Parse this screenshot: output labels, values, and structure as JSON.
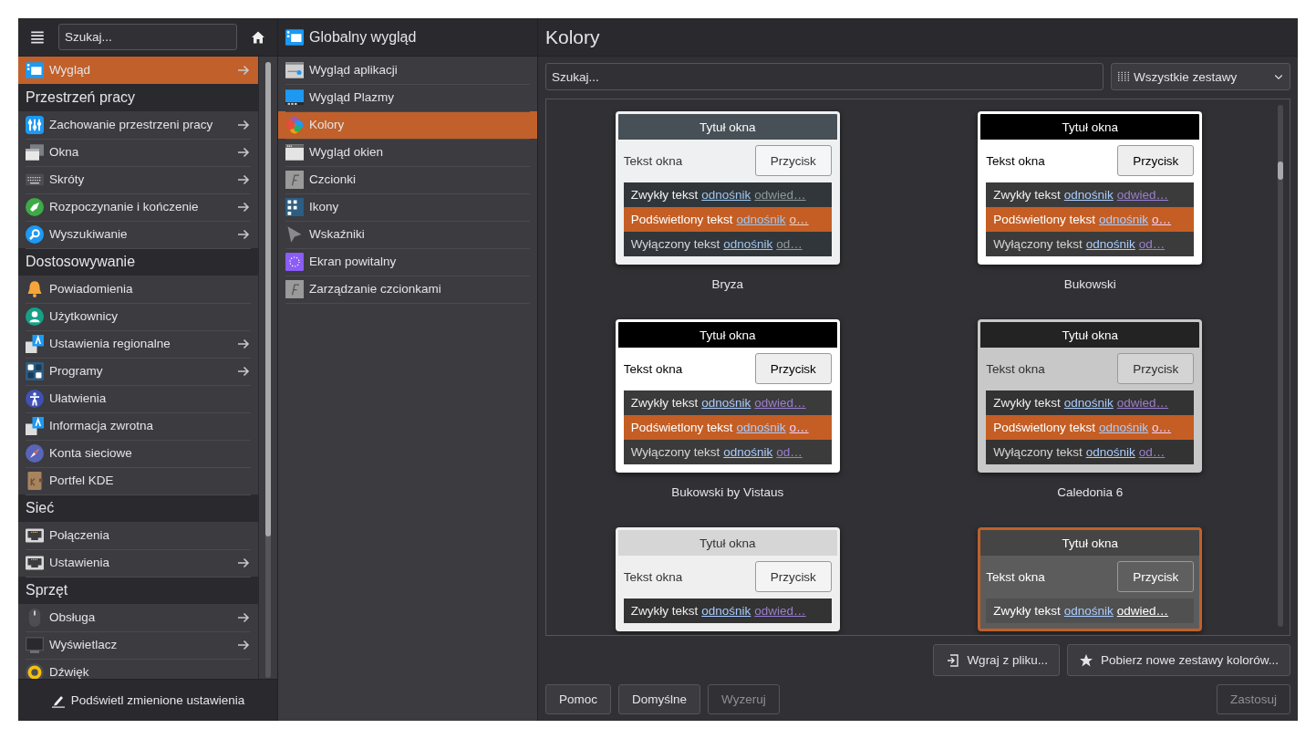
{
  "sidebar": {
    "search": {
      "placeholder": "Szukaj..."
    },
    "items": [
      {
        "kind": "item",
        "label": "Wygląd",
        "selected": true,
        "has_arrow": true
      },
      {
        "kind": "header",
        "label": "Przestrzeń pracy"
      },
      {
        "kind": "item",
        "label": "Zachowanie przestrzeni pracy",
        "selected": false,
        "has_arrow": true
      },
      {
        "kind": "item",
        "label": "Okna",
        "selected": false,
        "has_arrow": true
      },
      {
        "kind": "item",
        "label": "Skróty",
        "selected": false,
        "has_arrow": true
      },
      {
        "kind": "item",
        "label": "Rozpoczynanie i kończenie",
        "selected": false,
        "has_arrow": true
      },
      {
        "kind": "item",
        "label": "Wyszukiwanie",
        "selected": false,
        "has_arrow": true
      },
      {
        "kind": "header",
        "label": "Dostosowywanie"
      },
      {
        "kind": "item",
        "label": "Powiadomienia",
        "selected": false,
        "has_arrow": false
      },
      {
        "kind": "item",
        "label": "Użytkownicy",
        "selected": false,
        "has_arrow": false
      },
      {
        "kind": "item",
        "label": "Ustawienia regionalne",
        "selected": false,
        "has_arrow": true
      },
      {
        "kind": "item",
        "label": "Programy",
        "selected": false,
        "has_arrow": true
      },
      {
        "kind": "item",
        "label": "Ułatwienia",
        "selected": false,
        "has_arrow": false
      },
      {
        "kind": "item",
        "label": "Informacja zwrotna",
        "selected": false,
        "has_arrow": false
      },
      {
        "kind": "item",
        "label": "Konta sieciowe",
        "selected": false,
        "has_arrow": false
      },
      {
        "kind": "item",
        "label": "Portfel KDE",
        "selected": false,
        "has_arrow": false
      },
      {
        "kind": "header",
        "label": "Sieć"
      },
      {
        "kind": "item",
        "label": "Połączenia",
        "selected": false,
        "has_arrow": false
      },
      {
        "kind": "item",
        "label": "Ustawienia",
        "selected": false,
        "has_arrow": true
      },
      {
        "kind": "header",
        "label": "Sprzęt"
      },
      {
        "kind": "item",
        "label": "Obsługa",
        "selected": false,
        "has_arrow": true
      },
      {
        "kind": "item",
        "label": "Wyświetlacz",
        "selected": false,
        "has_arrow": true
      },
      {
        "kind": "item",
        "label": "Dźwięk",
        "selected": false,
        "has_arrow": false
      }
    ],
    "footer_button": "Podświetl zmienione ustawienia"
  },
  "subpanel": {
    "title": "Globalny wygląd",
    "items": [
      {
        "label": "Wygląd aplikacji",
        "selected": false
      },
      {
        "label": "Wygląd Plazmy",
        "selected": false
      },
      {
        "label": "Kolory",
        "selected": true
      },
      {
        "label": "Wygląd okien",
        "selected": false
      },
      {
        "label": "Czcionki",
        "selected": false
      },
      {
        "label": "Ikony",
        "selected": false
      },
      {
        "label": "Wskaźniki",
        "selected": false
      },
      {
        "label": "Ekran powitalny",
        "selected": false
      },
      {
        "label": "Zarządzanie czcionkami",
        "selected": false
      }
    ]
  },
  "content": {
    "title": "Kolory",
    "search": {
      "placeholder": "Szukaj..."
    },
    "filter": {
      "value": "Wszystkie zestawy"
    },
    "schemes": [
      {
        "name": "Bryza",
        "selected": false,
        "title": "Tytuł okna",
        "window_text": "Tekst okna",
        "button": "Przycisk",
        "rows": [
          {
            "kind": "normal",
            "text": "Zwykły tekst",
            "link": "odnośnik",
            "visited": "odwied…"
          },
          {
            "kind": "highlight",
            "text": "Podświetlony tekst",
            "link": "odnośnik",
            "visited": "o…"
          },
          {
            "kind": "disabled",
            "text": "Wyłączony tekst",
            "link": "odnośnik",
            "visited": "od…"
          }
        ]
      },
      {
        "name": "Bukowski",
        "selected": false,
        "title": "Tytuł okna",
        "window_text": "Tekst okna",
        "button": "Przycisk",
        "rows": [
          {
            "kind": "normal",
            "text": "Zwykły tekst",
            "link": "odnośnik",
            "visited": "odwied…"
          },
          {
            "kind": "highlight",
            "text": "Podświetlony tekst",
            "link": "odnośnik",
            "visited": "o…"
          },
          {
            "kind": "disabled",
            "text": "Wyłączony tekst",
            "link": "odnośnik",
            "visited": "od…"
          }
        ]
      },
      {
        "name": "Bukowski by Vistaus",
        "selected": false,
        "title": "Tytuł okna",
        "window_text": "Tekst okna",
        "button": "Przycisk",
        "rows": [
          {
            "kind": "normal",
            "text": "Zwykły tekst",
            "link": "odnośnik",
            "visited": "odwied…"
          },
          {
            "kind": "highlight",
            "text": "Podświetlony tekst",
            "link": "odnośnik",
            "visited": "o…"
          },
          {
            "kind": "disabled",
            "text": "Wyłączony tekst",
            "link": "odnośnik",
            "visited": "od…"
          }
        ]
      },
      {
        "name": "Caledonia 6",
        "selected": false,
        "title": "Tytuł okna",
        "window_text": "Tekst okna",
        "button": "Przycisk",
        "rows": [
          {
            "kind": "normal",
            "text": "Zwykły tekst",
            "link": "odnośnik",
            "visited": "odwied…"
          },
          {
            "kind": "highlight",
            "text": "Podświetlony tekst",
            "link": "odnośnik",
            "visited": "o…"
          },
          {
            "kind": "disabled",
            "text": "Wyłączony tekst",
            "link": "odnośnik",
            "visited": "od…"
          }
        ]
      },
      {
        "selected": false,
        "title": "Tytuł okna",
        "window_text": "Tekst okna",
        "button": "Przycisk",
        "rows": [
          {
            "kind": "normal",
            "text": "Zwykły tekst",
            "link": "odnośnik",
            "visited": "odwied…"
          }
        ]
      },
      {
        "selected": true,
        "title": "Tytuł okna",
        "window_text": "Tekst okna",
        "button": "Przycisk",
        "rows": [
          {
            "kind": "normal",
            "text": "Zwykły tekst",
            "link": "odnośnik",
            "visited": "odwied…"
          }
        ]
      }
    ],
    "actions": [
      {
        "kind": "file",
        "label": "Wgraj z pliku..."
      },
      {
        "kind": "download",
        "label": "Pobierz nowe zestawy kolorów..."
      }
    ],
    "buttons": [
      {
        "label": "Pomoc",
        "disabled": false
      },
      {
        "label": "Domyślne",
        "disabled": false
      },
      {
        "label": "Wyzeruj",
        "disabled": true
      }
    ],
    "apply_button": {
      "label": "Zastosuj",
      "disabled": true
    }
  }
}
